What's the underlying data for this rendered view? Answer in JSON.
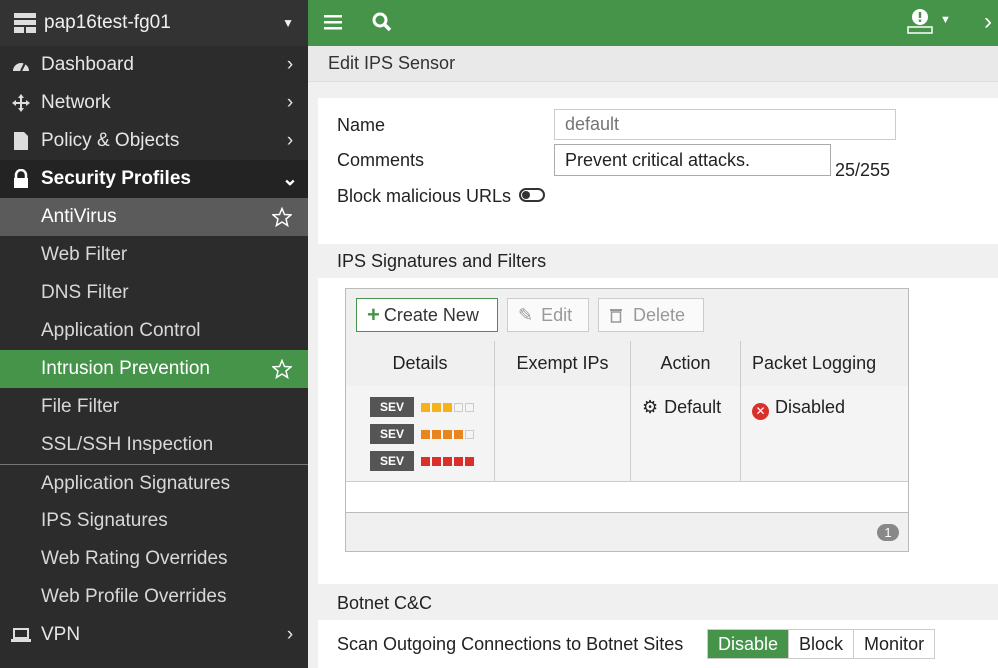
{
  "sidebar": {
    "device_name": "pap16test-fg01",
    "items": [
      {
        "label": "Dashboard"
      },
      {
        "label": "Network"
      },
      {
        "label": "Policy & Objects"
      },
      {
        "label": "Security Profiles"
      },
      {
        "label": "AntiVirus"
      },
      {
        "label": "Web Filter"
      },
      {
        "label": "DNS Filter"
      },
      {
        "label": "Application Control"
      },
      {
        "label": "Intrusion Prevention"
      },
      {
        "label": "File Filter"
      },
      {
        "label": "SSL/SSH Inspection"
      },
      {
        "label": "Application Signatures"
      },
      {
        "label": "IPS Signatures"
      },
      {
        "label": "Web Rating Overrides"
      },
      {
        "label": "Web Profile Overrides"
      },
      {
        "label": "VPN"
      }
    ]
  },
  "topbar": {
    "icons": [
      "menu-icon",
      "search-icon",
      "notification-icon",
      "expand-icon"
    ]
  },
  "page": {
    "title": "Edit IPS Sensor"
  },
  "form": {
    "name_label": "Name",
    "name_placeholder": "default",
    "comments_label": "Comments",
    "comments_value": "Prevent critical attacks.",
    "comments_count": "25/255",
    "block_urls_label": "Block malicious URLs",
    "block_urls_enabled": false
  },
  "ips": {
    "section_title": "IPS Signatures and Filters",
    "toolbar": {
      "create": "Create New",
      "edit": "Edit",
      "delete": "Delete"
    },
    "columns": [
      "Details",
      "Exempt IPs",
      "Action",
      "Packet Logging"
    ],
    "rows": [
      {
        "sev_tag": "SEV",
        "severity_levels": [
          3,
          4,
          5
        ],
        "exempt_ips": "",
        "action": "Default",
        "packet_logging": "Disabled"
      }
    ],
    "colors": {
      "sev3": "#f5b21b",
      "sev4": "#e8861d",
      "sev5": "#d9302b"
    },
    "page_count": "1"
  },
  "botnet": {
    "section_title": "Botnet C&C",
    "scan_label": "Scan Outgoing Connections to Botnet Sites",
    "options": [
      "Disable",
      "Block",
      "Monitor"
    ],
    "selected": "Disable"
  },
  "colors": {
    "accent": "#45944a",
    "sidebar_bg": "#2c2c2c"
  }
}
